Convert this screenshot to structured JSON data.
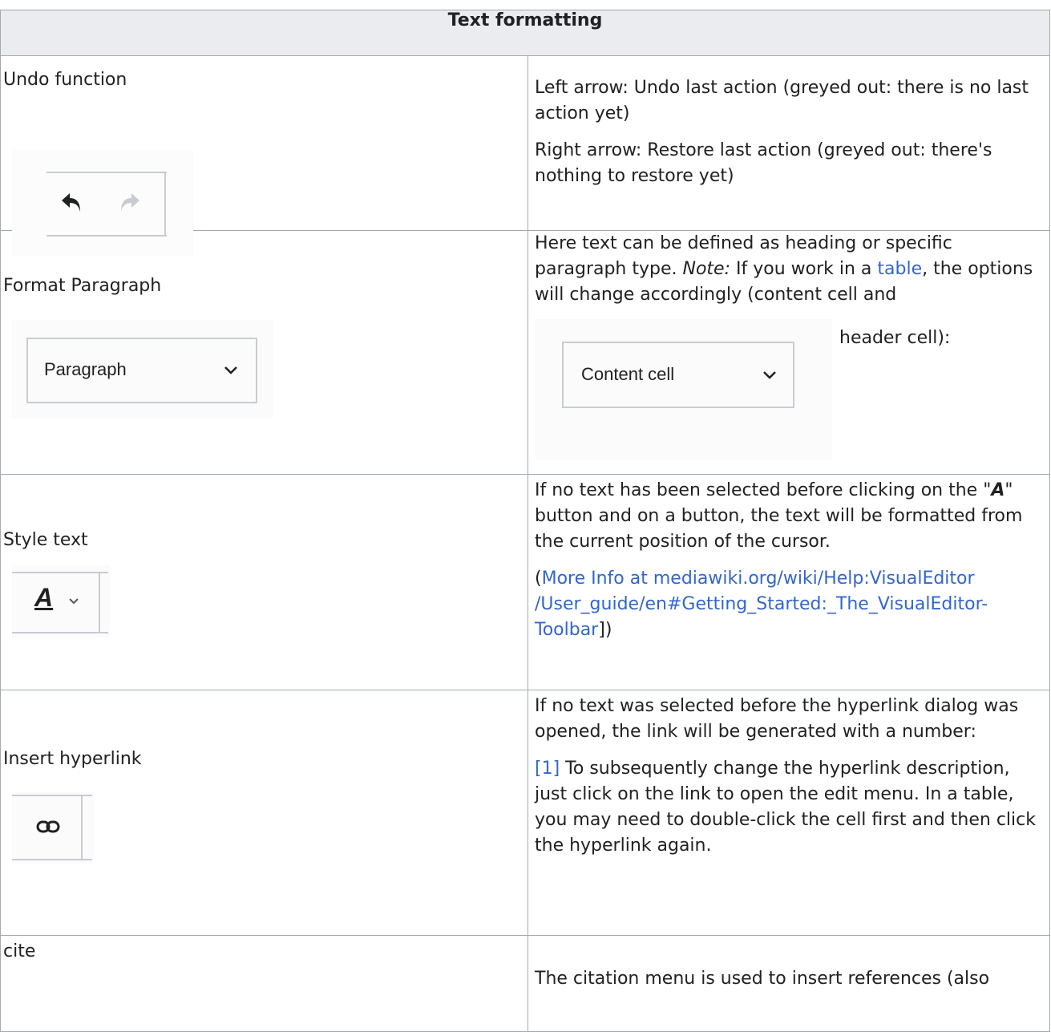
{
  "table": {
    "header": "Text formatting"
  },
  "rows": {
    "undo": {
      "label": "Undo function",
      "icons": [
        "undo-arrow-icon",
        "redo-arrow-icon"
      ],
      "desc1": "Left arrow: Undo last action (greyed out: there is no last action yet)",
      "desc2": "Right arrow: Restore last action (greyed out: there's nothing to restore yet)"
    },
    "paragraph": {
      "label": "Format Paragraph",
      "dropdown": "Paragraph",
      "desc_a": "Here text can be defined as heading or specific paragraph type. ",
      "desc_note": "Note:",
      "desc_b": " If you work in a ",
      "desc_link": "table",
      "desc_c": ", the options will change accordingly (content cell and",
      "desc_d": "header cell):",
      "dropdown2": "Content cell"
    },
    "style": {
      "label": "Style text",
      "icon_letter": "A",
      "desc_a": "If no text has been selected before clicking on the \"",
      "desc_letter": "A",
      "desc_b": "\" button and on a button, the text will be formatted from the current position of the cursor.",
      "info_open": "(",
      "info_link": "More Info at mediawiki.org/wiki/Help:VisualEditor /User_guide/en#Getting_Started:_The_VisualEditor-Toolbar",
      "info_close": "])"
    },
    "hyperlink": {
      "label": "Insert hyperlink",
      "desc1": "If no text was selected before the hyperlink dialog was opened, the link will be generated with a number:",
      "ref": "[1]",
      "desc2": " To subsequently change the hyperlink description, just click on the link to open the edit menu. In a table, you may need to double-click the cell first and then click the hyperlink again."
    },
    "cite": {
      "label": "cite",
      "desc": "The citation menu is used to insert references (also"
    }
  },
  "colors": {
    "link": "#3366cc",
    "header_bg": "#eaecf0",
    "border": "#a2a9b1"
  }
}
